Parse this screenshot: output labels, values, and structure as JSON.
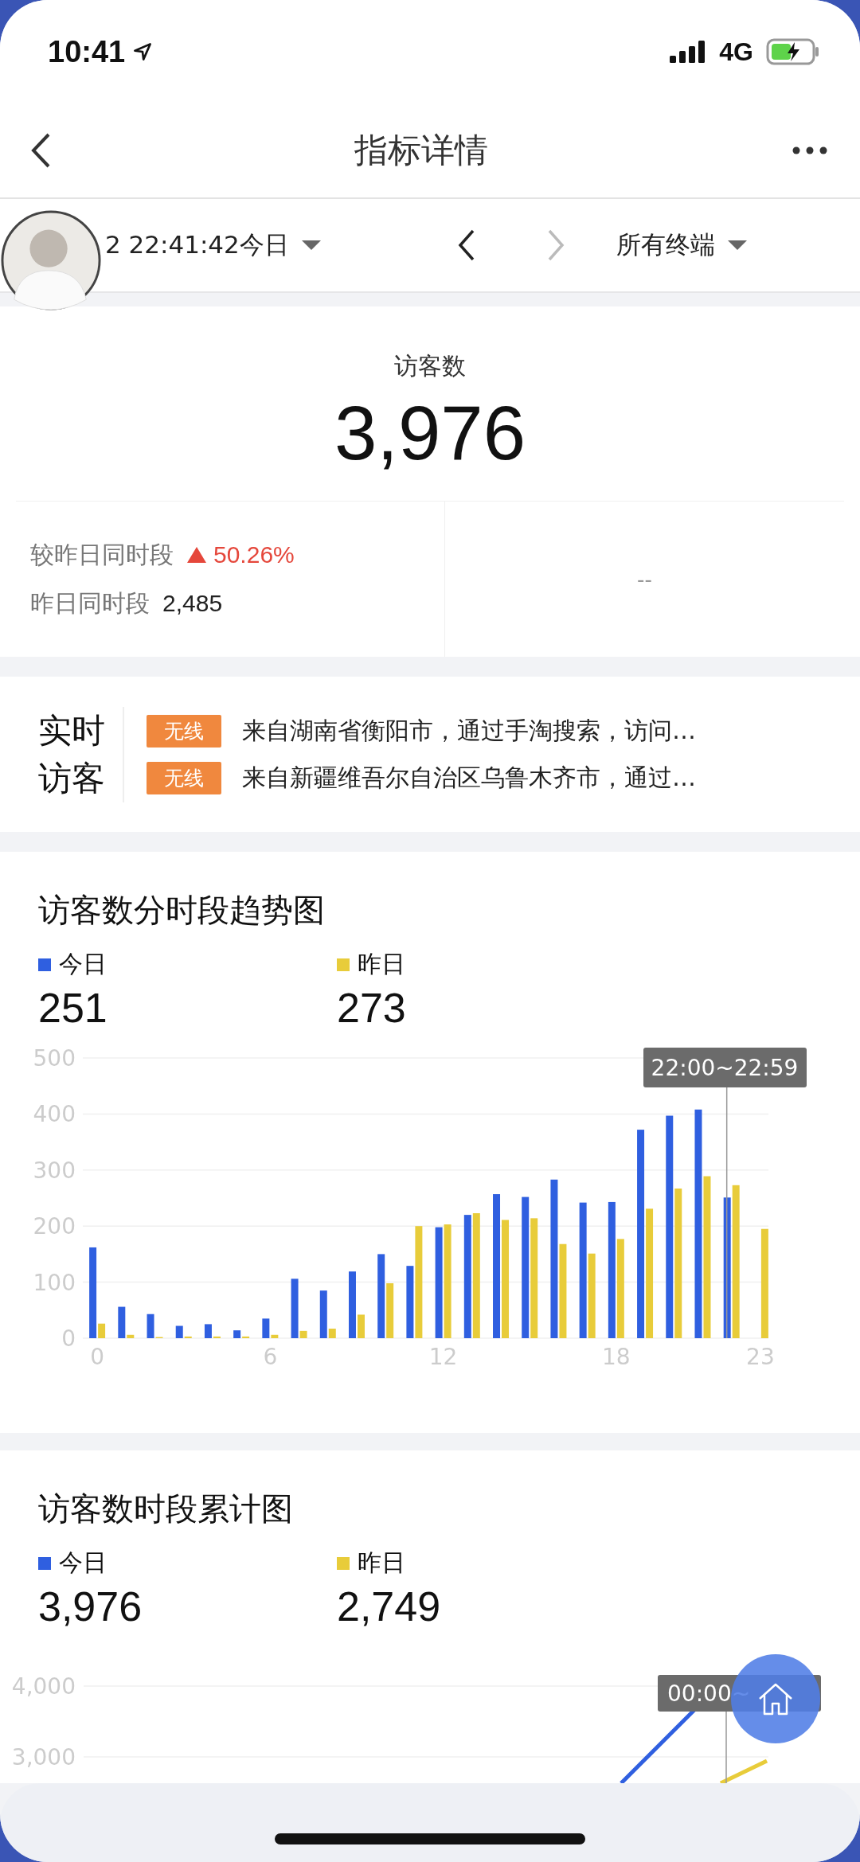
{
  "status_bar": {
    "time": "10:41",
    "network": "4G"
  },
  "nav": {
    "title": "指标详情"
  },
  "filter": {
    "date": "2 22:41:42今日",
    "terminal": "所有终端",
    "next_disabled": true
  },
  "metric": {
    "label": "访客数",
    "value": "3,976",
    "compare_label": "较昨日同时段",
    "rising": true,
    "change": "50.26%",
    "yesterday_label": "昨日同时段",
    "yesterday_value": "2,485",
    "right_value": "--"
  },
  "realtime": {
    "title_lines": [
      "实时",
      "访客"
    ],
    "items": [
      {
        "tag": "无线",
        "text": "来自湖南省衡阳市，通过手淘搜索，访问…"
      },
      {
        "tag": "无线",
        "text": "来自新疆维吾尔自治区乌鲁木齐市，通过…"
      }
    ]
  },
  "trend_chart": {
    "title": "访客数分时段趋势图",
    "tooltip": "22:00~22:59",
    "legend": [
      {
        "value": "251"
      },
      {
        "value": "273"
      }
    ],
    "chart_data": {
      "type": "bar",
      "x": [
        0,
        1,
        2,
        3,
        4,
        5,
        6,
        7,
        8,
        9,
        10,
        11,
        12,
        13,
        14,
        15,
        16,
        17,
        18,
        19,
        20,
        21,
        22,
        23
      ],
      "xlim": [
        -0.5,
        23.5
      ],
      "ylim": [
        0,
        500
      ],
      "yticks": [
        0,
        100,
        200,
        300,
        400,
        500
      ],
      "xticks": [
        0,
        6,
        12,
        18,
        23
      ],
      "grid": true,
      "ref_lines": [
        {
          "axis": "x",
          "value": 22
        }
      ],
      "series": [
        {
          "name": "今日",
          "color": "#2f5fe0",
          "values": [
            162,
            56,
            43,
            22,
            25,
            14,
            35,
            106,
            85,
            119,
            150,
            129,
            198,
            220,
            257,
            252,
            283,
            242,
            243,
            372,
            397,
            408,
            251,
            null
          ]
        },
        {
          "name": "昨日",
          "color": "#e8cc3a",
          "values": [
            26,
            6,
            2,
            3,
            3,
            3,
            6,
            13,
            17,
            42,
            98,
            200,
            203,
            223,
            211,
            214,
            168,
            151,
            177,
            231,
            267,
            289,
            273,
            195
          ]
        }
      ]
    }
  },
  "cumulative_chart": {
    "title": "访客数时段累计图",
    "legend": [
      {
        "label": "今日",
        "color": "#2f5fe0",
        "value": "3,976"
      },
      {
        "label": "昨日",
        "color": "#e8cc3a",
        "value": "2,749"
      }
    ],
    "y_labels": [
      "4,000",
      "3,000"
    ],
    "tooltip": "00:00~"
  }
}
